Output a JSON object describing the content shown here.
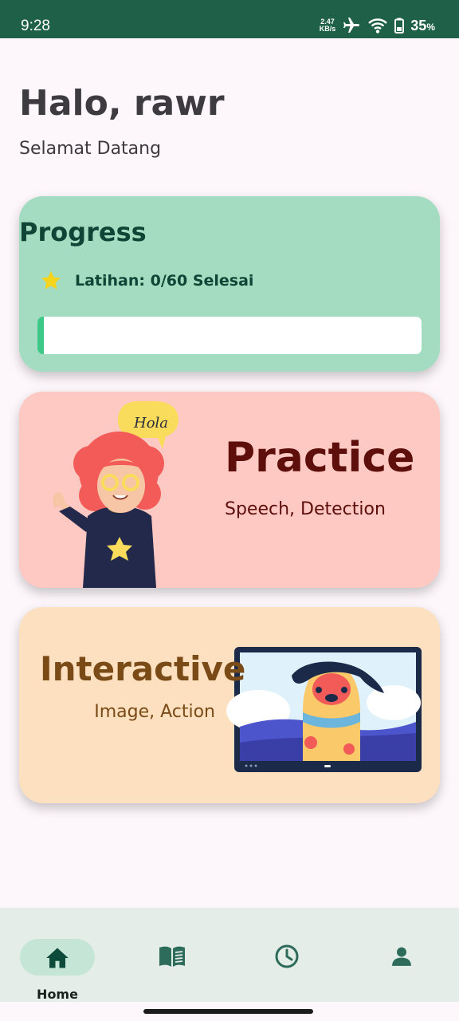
{
  "status_bar": {
    "time": "9:28",
    "net_speed_value": "2.47",
    "net_speed_unit": "KB/s",
    "battery": "35",
    "battery_unit": "%",
    "icons": [
      "airplane-icon",
      "wifi-icon",
      "battery-icon"
    ]
  },
  "header": {
    "greeting": "Halo, rawr",
    "subtitle": "Selamat Datang"
  },
  "progress_card": {
    "title": "Progress",
    "label": "Latihan: 0/60 Selesai",
    "completed": 0,
    "total": 60,
    "star_color": "#f7d51e"
  },
  "practice_card": {
    "title": "Practice",
    "subtitle": "Speech, Detection",
    "illustration_text": "Hola"
  },
  "interactive_card": {
    "title": "Interactive",
    "subtitle": "Image, Action"
  },
  "bottom_nav": {
    "items": [
      {
        "label": "Home",
        "icon": "home-icon",
        "active": true
      },
      {
        "label": "",
        "icon": "book-icon",
        "active": false
      },
      {
        "label": "",
        "icon": "clock-icon",
        "active": false
      },
      {
        "label": "",
        "icon": "person-icon",
        "active": false
      }
    ]
  },
  "colors": {
    "status_bar": "#1f6148",
    "progress_card": "#a3dcc0",
    "practice_card": "#fdc9c2",
    "interactive_card": "#fde0bf",
    "nav_active": "#c5e5d6",
    "nav_icon": "#2d6b5a"
  }
}
